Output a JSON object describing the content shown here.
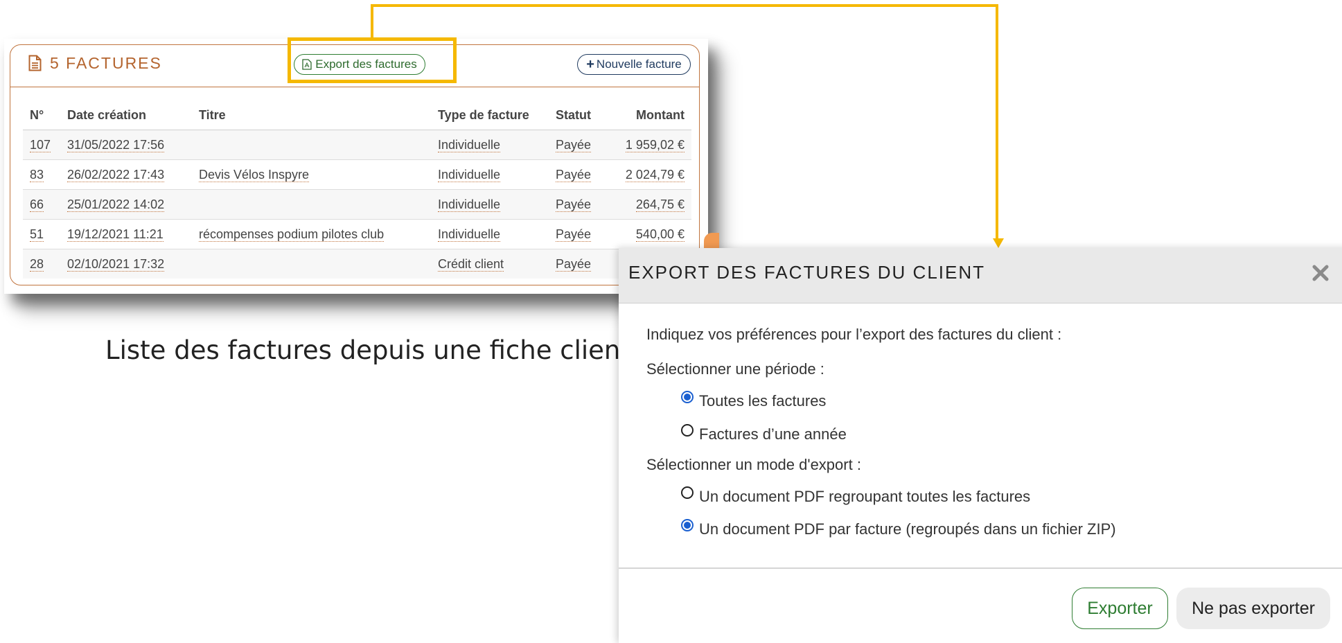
{
  "invoices_panel": {
    "title": "5 FACTURES",
    "export_button": "Export des factures",
    "new_button": "Nouvelle facture",
    "columns": [
      "N°",
      "Date création",
      "Titre",
      "Type de facture",
      "Statut",
      "Montant"
    ],
    "rows": [
      {
        "num": "107",
        "date": "31/05/2022 17:56",
        "title": "",
        "type": "Individuelle",
        "status": "Payée",
        "amount": "1 959,02 €"
      },
      {
        "num": "83",
        "date": "26/02/2022 17:43",
        "title": "Devis Vélos Inspyre",
        "type": "Individuelle",
        "status": "Payée",
        "amount": "2 024,79 €"
      },
      {
        "num": "66",
        "date": "25/01/2022 14:02",
        "title": "",
        "type": "Individuelle",
        "status": "Payée",
        "amount": "264,75 €"
      },
      {
        "num": "51",
        "date": "19/12/2021 11:21",
        "title": "récompenses podium pilotes club",
        "type": "Individuelle",
        "status": "Payée",
        "amount": "540,00 €"
      },
      {
        "num": "28",
        "date": "02/10/2021 17:32",
        "title": "",
        "type": "Crédit client",
        "status": "Payée",
        "amount": ""
      }
    ],
    "accent_color": "#c0743e",
    "highlight_color": "#f5b800"
  },
  "caption": "Liste des factures depuis une fiche client",
  "dialog": {
    "title": "EXPORT DES FACTURES DU CLIENT",
    "close_icon": "close-icon",
    "intro": "Indiquez vos préférences pour l’export des factures du client :",
    "period_label": "Sélectionner une période :",
    "period_options": [
      {
        "label": "Toutes les factures",
        "checked": true
      },
      {
        "label": "Factures d’une année",
        "checked": false
      }
    ],
    "mode_label": "Sélectionner un mode d'export :",
    "mode_options": [
      {
        "label": "Un document PDF regroupant toutes les factures",
        "checked": false
      },
      {
        "label": "Un document PDF par facture (regroupés dans un fichier ZIP)",
        "checked": true
      }
    ],
    "export_button": "Exporter",
    "cancel_button": "Ne pas exporter"
  }
}
